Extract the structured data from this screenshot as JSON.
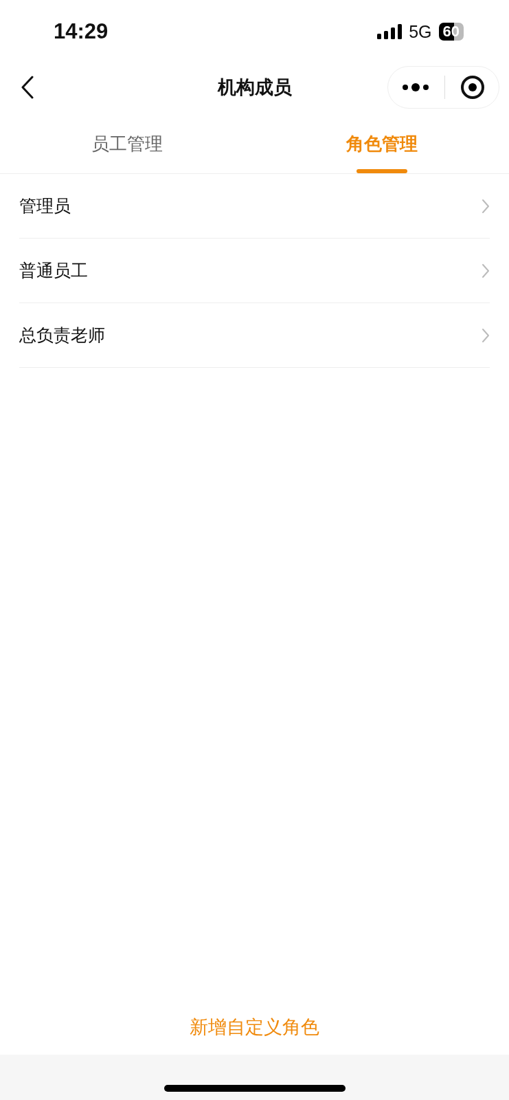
{
  "status_bar": {
    "time": "14:29",
    "network": "5G",
    "battery": "60"
  },
  "nav_bar": {
    "title": "机构成员"
  },
  "tabs": [
    {
      "label": "员工管理",
      "selected": false
    },
    {
      "label": "角色管理",
      "selected": true
    }
  ],
  "roles": [
    {
      "name": "管理员"
    },
    {
      "name": "普通员工"
    },
    {
      "name": "总负责老师"
    }
  ],
  "add_button": {
    "label": "新增自定义角色"
  }
}
